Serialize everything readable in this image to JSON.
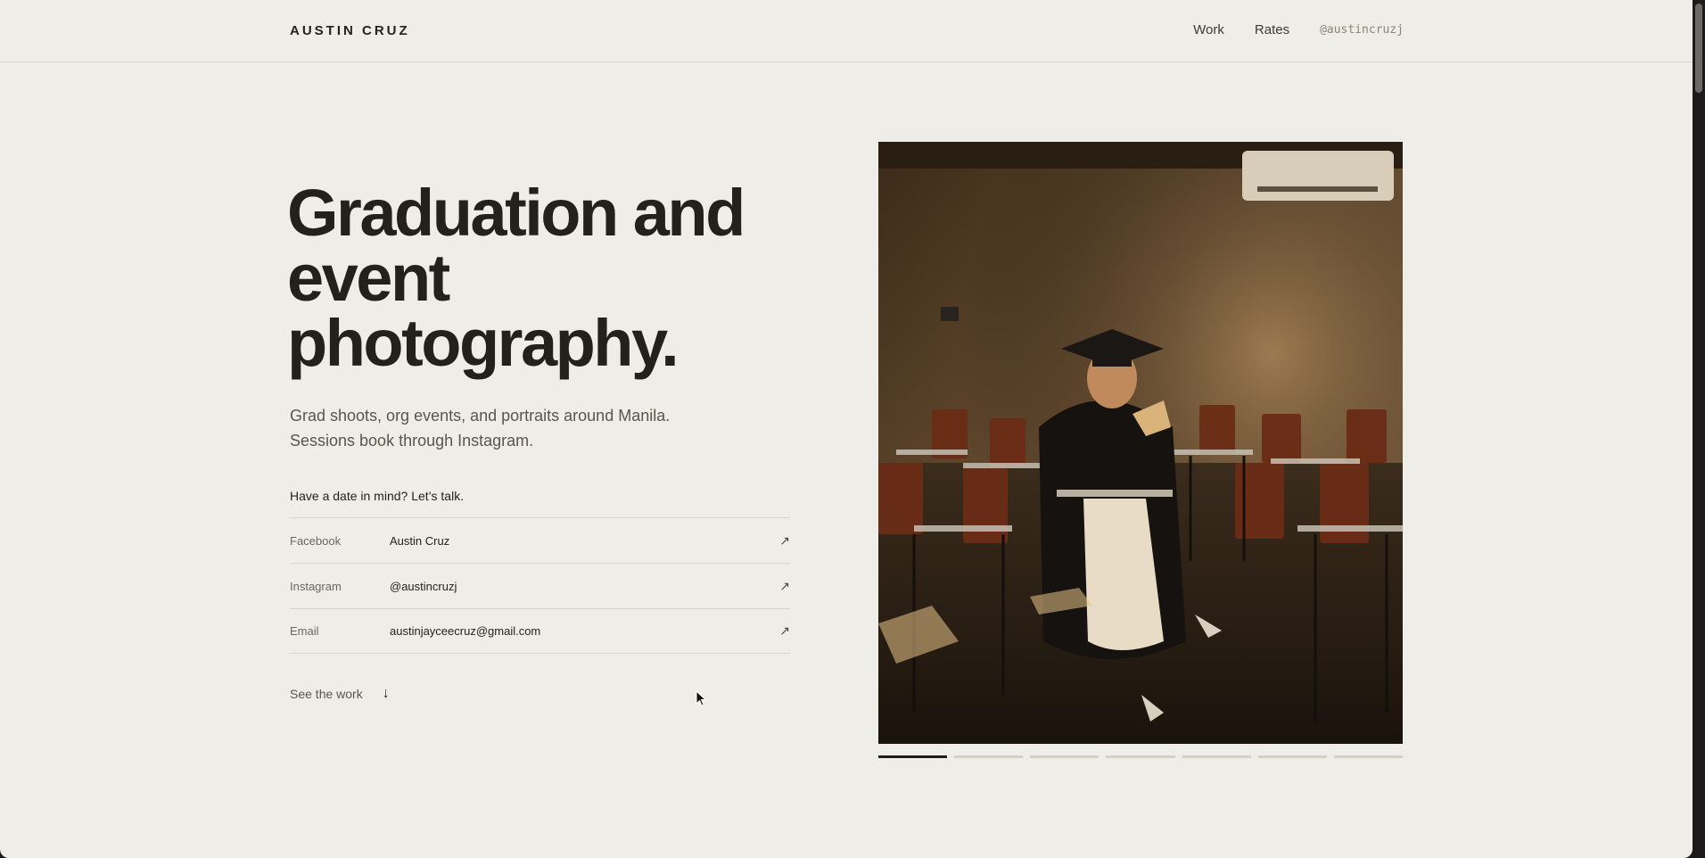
{
  "header": {
    "brand": "AUSTIN CRUZ",
    "nav": [
      {
        "label": "Work"
      },
      {
        "label": "Rates"
      }
    ],
    "handle": "@austincruzj"
  },
  "hero": {
    "title": "Graduation and event photography.",
    "lede": "Grad shoots, org events, and portraits around Manila. Sessions book through Instagram.",
    "cta": "Have a date in mind? Let’s talk.",
    "contacts": [
      {
        "label": "Facebook",
        "value": "Austin Cruz",
        "arrow": "↗"
      },
      {
        "label": "Instagram",
        "value": "@austincruzj",
        "arrow": "↗"
      },
      {
        "label": "Email",
        "value": "austinjayceecruz@gmail.com",
        "arrow": "↗"
      }
    ],
    "see_work": "See the work",
    "see_work_arrow": "↓"
  },
  "gallery": {
    "slide_count": 7,
    "active_slide": 1
  }
}
